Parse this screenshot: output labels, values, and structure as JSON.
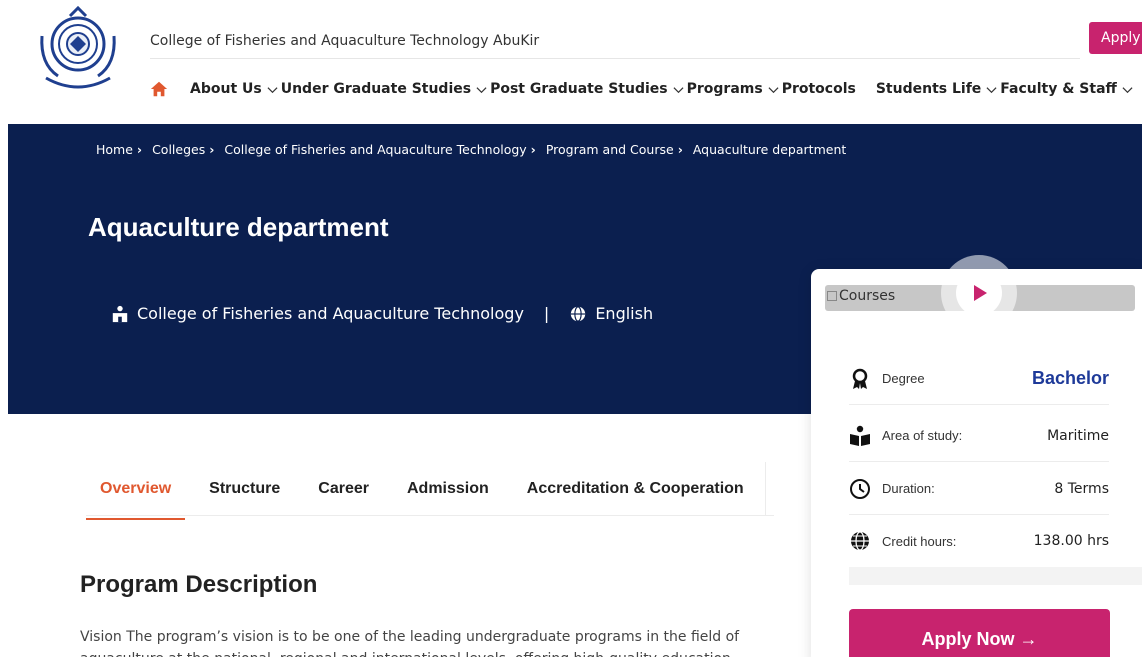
{
  "header": {
    "college_name": "College of Fisheries and Aquaculture Technology  AbuKir",
    "apply_button": "Apply",
    "nav": [
      {
        "label": "About Us"
      },
      {
        "label": "Under Graduate Studies"
      },
      {
        "label": "Post Graduate Studies"
      },
      {
        "label": "Programs"
      },
      {
        "label": "Protocols"
      },
      {
        "label": "Students Life"
      },
      {
        "label": "Faculty & Staff"
      }
    ]
  },
  "breadcrumb": [
    "Home",
    "Colleges",
    "College of Fisheries and Aquaculture Technology",
    "Program and Course",
    "Aquaculture department"
  ],
  "hero": {
    "title": "Aquaculture department",
    "college": "College of Fisheries and Aquaculture Technology",
    "separator": "|",
    "language": "English"
  },
  "tabs": [
    "Overview",
    "Structure",
    "Career",
    "Admission",
    "Accreditation & Cooperation"
  ],
  "content": {
    "section_title": "Program Description",
    "description": "Vision The program’s vision is to be one of the leading undergraduate programs in the field of aquaculture at the national, regional and international levels, offering high-quality education"
  },
  "card": {
    "media_alt": "Courses",
    "rows": [
      {
        "label": "Degree",
        "value": "Bachelor"
      },
      {
        "label": "Area of study:",
        "value": "Maritime"
      },
      {
        "label": "Duration:",
        "value": "8 Terms"
      },
      {
        "label": "Credit hours:",
        "value": "138.00 hrs"
      }
    ],
    "apply_now": "Apply Now →"
  },
  "colors": {
    "brand_magenta": "#c8236e",
    "hero_navy": "#0b1f4f",
    "tab_active": "#e0582f",
    "degree_blue": "#1e3a99"
  },
  "icons": [
    "university-seal-logo",
    "home-icon",
    "chevron-down-icon",
    "building-icon",
    "globe-icon",
    "play-icon",
    "award-icon",
    "reader-icon",
    "clock-icon",
    "globe-icon"
  ]
}
